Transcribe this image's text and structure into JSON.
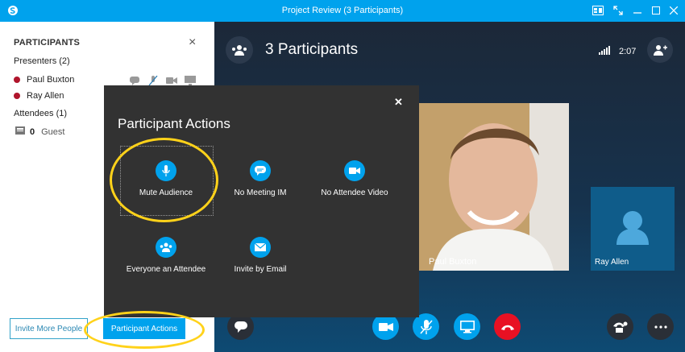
{
  "window": {
    "title": "Project Review (3 Participants)"
  },
  "participants_panel": {
    "heading": "PARTICIPANTS",
    "presenters_label": "Presenters (2)",
    "presenters": [
      {
        "name": "Paul Buxton"
      },
      {
        "name": "Ray Allen"
      }
    ],
    "attendees_label": "Attendees (1)",
    "guest_count": "0",
    "guest_label": "Guest",
    "invite_button": "Invite More People",
    "actions_button": "Participant Actions"
  },
  "main": {
    "title": "3 Participants",
    "timer": "2:07",
    "tiles": [
      {
        "name": "Paul Buxton"
      },
      {
        "name": "Ray Allen"
      }
    ]
  },
  "popup": {
    "title": "Participant Actions",
    "actions": [
      {
        "label": "Mute Audience",
        "icon": "microphone-icon"
      },
      {
        "label": "No Meeting IM",
        "icon": "chat-bubble-icon"
      },
      {
        "label": "No Attendee Video",
        "icon": "video-camera-icon"
      },
      {
        "label": "Everyone an Attendee",
        "icon": "people-icon"
      },
      {
        "label": "Invite by Email",
        "icon": "email-icon"
      }
    ]
  },
  "colors": {
    "accent": "#00a2ed",
    "hangup": "#e81123",
    "highlight": "#ffd21a",
    "presence": "#b0152c"
  }
}
